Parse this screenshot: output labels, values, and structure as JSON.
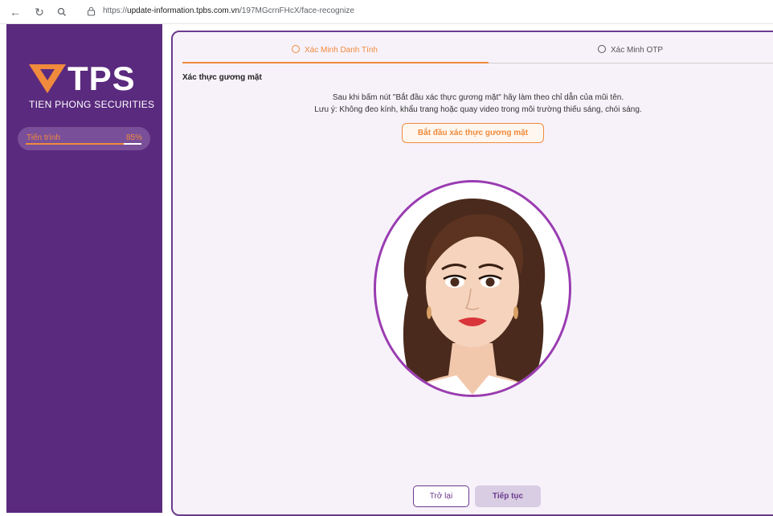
{
  "browser": {
    "url_prefix": "https://",
    "url_host": "update-information.tpbs.com.vn",
    "url_path": "/197MGcrnFHcX/face-recognize"
  },
  "sidebar": {
    "brand": "TPS",
    "brand_sub": "TIEN PHONG SECURITIES",
    "progress_label": "Tiến trình",
    "progress_value": "85%",
    "progress_fraction": 0.85,
    "colors": {
      "background": "#5a2a7e",
      "accent": "#f08a3c"
    }
  },
  "steps": [
    {
      "label": "Xác Minh Danh Tính",
      "active": true
    },
    {
      "label": "Xác Minh OTP",
      "active": false
    }
  ],
  "main": {
    "section_title": "Xác thực gương mặt",
    "instruction_1": "Sau khi bấm nút \"Bắt đầu xác thực gương mặt\" hãy làm theo chỉ dẫn của mũi tên.",
    "instruction_2": "Lưu ý: Không đeo kính, khẩu trang hoặc quay video trong môi trường thiếu sáng, chói sáng.",
    "start_button": "Bắt đầu xác thực gương mặt"
  },
  "footer": {
    "back_button": "Trở lại",
    "next_button": "Tiếp tục"
  }
}
